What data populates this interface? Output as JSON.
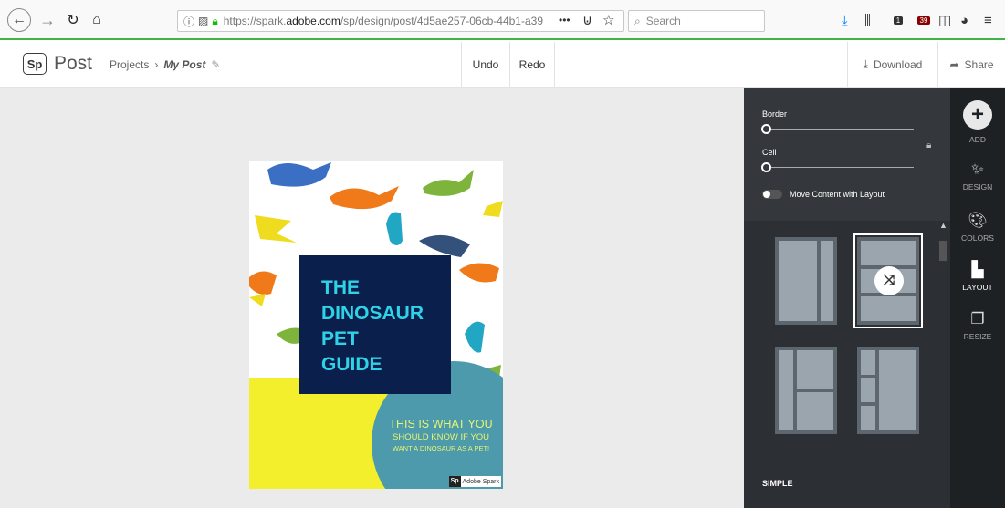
{
  "browser": {
    "url_prefix": "https://spark.",
    "url_domain": "adobe.com",
    "url_path": "/sp/design/post/4d5ae257-06cb-44b1-a39",
    "search_placeholder": "Search",
    "more_label": "•••",
    "badge1": "1",
    "badge2": "39"
  },
  "header": {
    "logo": "Sp",
    "app_name": "Post",
    "breadcrumb_projects": "Projects",
    "breadcrumb_sep": "›",
    "breadcrumb_current": "My Post",
    "undo": "Undo",
    "redo": "Redo",
    "download": "Download",
    "share": "Share"
  },
  "poster": {
    "title_lines": [
      "THE",
      "DINOSAUR",
      "PET",
      "GUIDE"
    ],
    "sub1": "THIS IS WHAT YOU",
    "sub2": "SHOULD KNOW IF YOU",
    "sub3": "WANT A DINOSAUR AS A PET!",
    "badge_logo": "Sp",
    "badge_text": "Adobe Spark",
    "colors": {
      "title_bg": "#0b1f4c",
      "title_text": "#2fd3e8",
      "yellow": "#f3ef2c",
      "circle": "#4c9aab"
    }
  },
  "panel": {
    "border_label": "Border",
    "cell_label": "Cell",
    "toggle_label": "Move Content with Layout",
    "section_label": "SIMPLE",
    "border_value": 0,
    "cell_value": 0
  },
  "toolbar": {
    "add": "ADD",
    "design": "DESIGN",
    "colors": "COLORS",
    "layout": "LAYOUT",
    "resize": "RESIZE"
  }
}
